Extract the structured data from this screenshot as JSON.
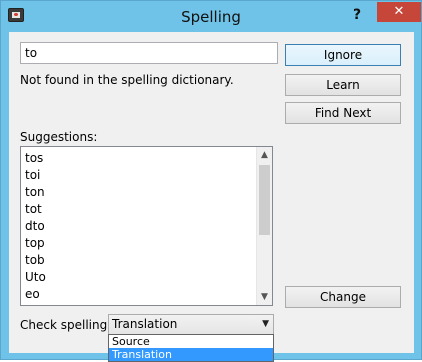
{
  "window": {
    "title": "Spelling",
    "help_label": "?",
    "close_label": "✕"
  },
  "spell": {
    "word": "to",
    "status": "Not found in the spelling dictionary.",
    "suggestions_label": "Suggestions:",
    "suggestions": [
      "tos",
      "toi",
      "ton",
      "tot",
      "dto",
      "top",
      "tob",
      "Uto",
      "eo"
    ]
  },
  "buttons": {
    "ignore": "Ignore",
    "learn": "Learn",
    "find_next": "Find Next",
    "change": "Change"
  },
  "check": {
    "label": "Check spelling in:",
    "selected": "Translation",
    "options": [
      "Source",
      "Translation"
    ]
  },
  "icons": {
    "scroll_up": "▲",
    "scroll_down": "▼",
    "select_arrow": "▼"
  }
}
